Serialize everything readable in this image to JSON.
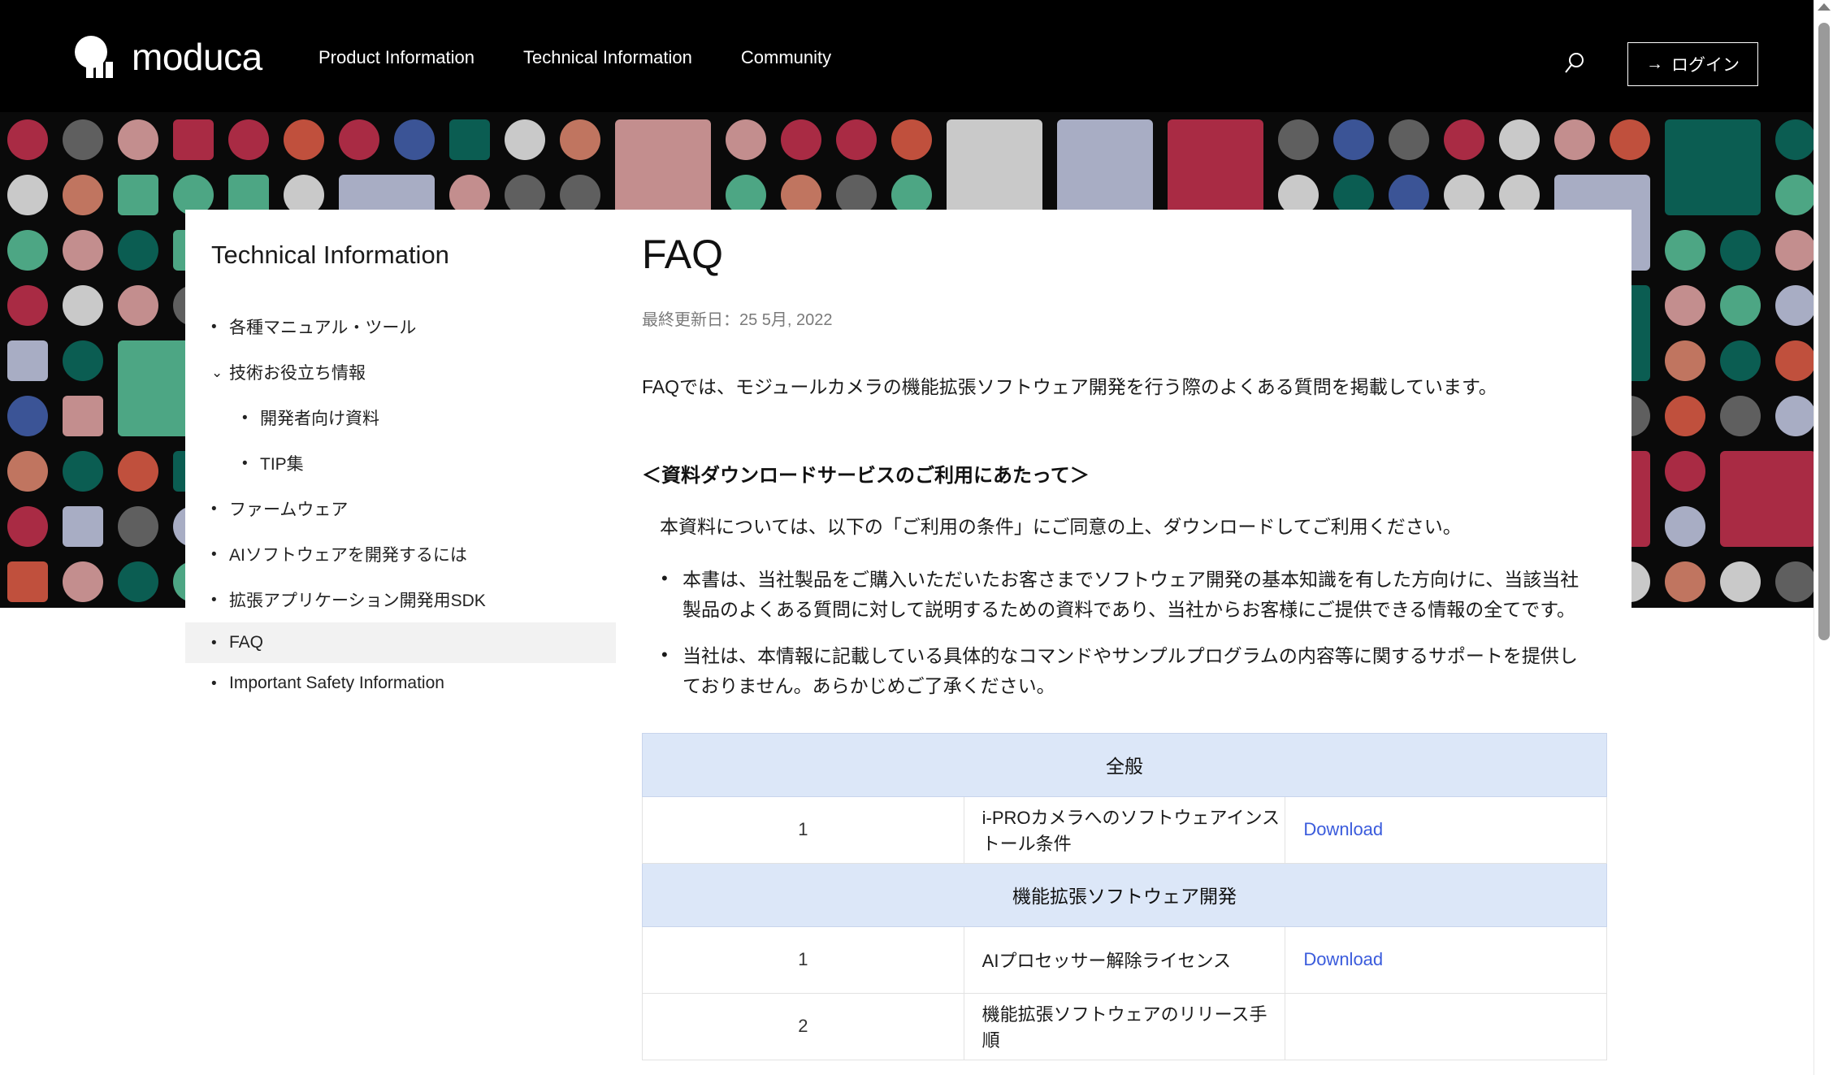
{
  "header": {
    "brand": "moduca",
    "logo_icon": "moduca-logo-icon",
    "nav": [
      {
        "label": "Product Information"
      },
      {
        "label": "Technical Information"
      },
      {
        "label": "Community"
      }
    ],
    "search_icon": "search-icon",
    "login_label": "ログイン",
    "login_arrow": "→"
  },
  "sidebar": {
    "title": "Technical Information",
    "items": [
      {
        "label": "各種マニュアル・ツール",
        "marker": "•",
        "level": 0,
        "active": false
      },
      {
        "label": "技術お役立ち情報",
        "marker": "chevron-down",
        "level": 0,
        "active": false
      },
      {
        "label": "開発者向け資料",
        "marker": "•",
        "level": 1,
        "active": false
      },
      {
        "label": "TIP集",
        "marker": "•",
        "level": 1,
        "active": false
      },
      {
        "label": "ファームウェア",
        "marker": "•",
        "level": 0,
        "active": false
      },
      {
        "label": "AIソフトウェアを開発するには",
        "marker": "•",
        "level": 0,
        "active": false
      },
      {
        "label": "拡張アプリケーション開発用SDK",
        "marker": "•",
        "level": 0,
        "active": false
      },
      {
        "label": "FAQ",
        "marker": "•",
        "level": 0,
        "active": true
      },
      {
        "label": "Important Safety Information",
        "marker": "•",
        "level": 0,
        "active": false
      }
    ]
  },
  "main": {
    "title": "FAQ",
    "updated": "最終更新日：25 5月, 2022",
    "intro": "FAQでは、モジュールカメラの機能拡張ソフトウェア開発を行う際のよくある質問を掲載しています。",
    "section_title": "＜資料ダウンロードサービスのご利用にあたって＞",
    "section_lead": "本資料については、以下の「ご利用の条件」にご同意の上、ダウンロードしてご利用ください。",
    "terms": [
      "本書は、当社製品をご購入いただいたお客さまでソフトウェア開発の基本知識を有した方向けに、当該当社製品のよくある質問に対して説明するための資料であり、当社からお客様にご提供できる情報の全てです。",
      "当社は、本情報に記載している具体的なコマンドやサンプルプログラムの内容等に関するサポートを提供しておりません。あらかじめご了承ください。"
    ],
    "table": {
      "download_label": "Download",
      "groups": [
        {
          "heading": "全般",
          "rows": [
            {
              "num": "1",
              "title": "i-PROカメラへのソフトウェアインストール条件",
              "download": "Download"
            }
          ]
        },
        {
          "heading": "機能拡張ソフトウェア開発",
          "rows": [
            {
              "num": "1",
              "title": "AIプロセッサー解除ライセンス",
              "download": "Download"
            },
            {
              "num": "2",
              "title": "機能拡張ソフトウェアのリリース手順",
              "download": ""
            }
          ]
        }
      ]
    }
  },
  "colors": {
    "topbar_bg": "#000000",
    "pattern_bg": "#0a0a0a",
    "table_header_bg": "#dce7f8",
    "link_blue": "#3a5bdc",
    "active_item_bg": "#f2f2f2",
    "palette": [
      "#3b5496",
      "#c9c9c9",
      "#c38e8e",
      "#0b5d52",
      "#4da684",
      "#a8adc4",
      "#c07560",
      "#5f5f5f",
      "#c0503d",
      "#a92b44"
    ]
  },
  "scrollbar": {
    "up_arrow_icon": "scroll-up-arrow-icon",
    "thumb": "scroll-thumb"
  }
}
